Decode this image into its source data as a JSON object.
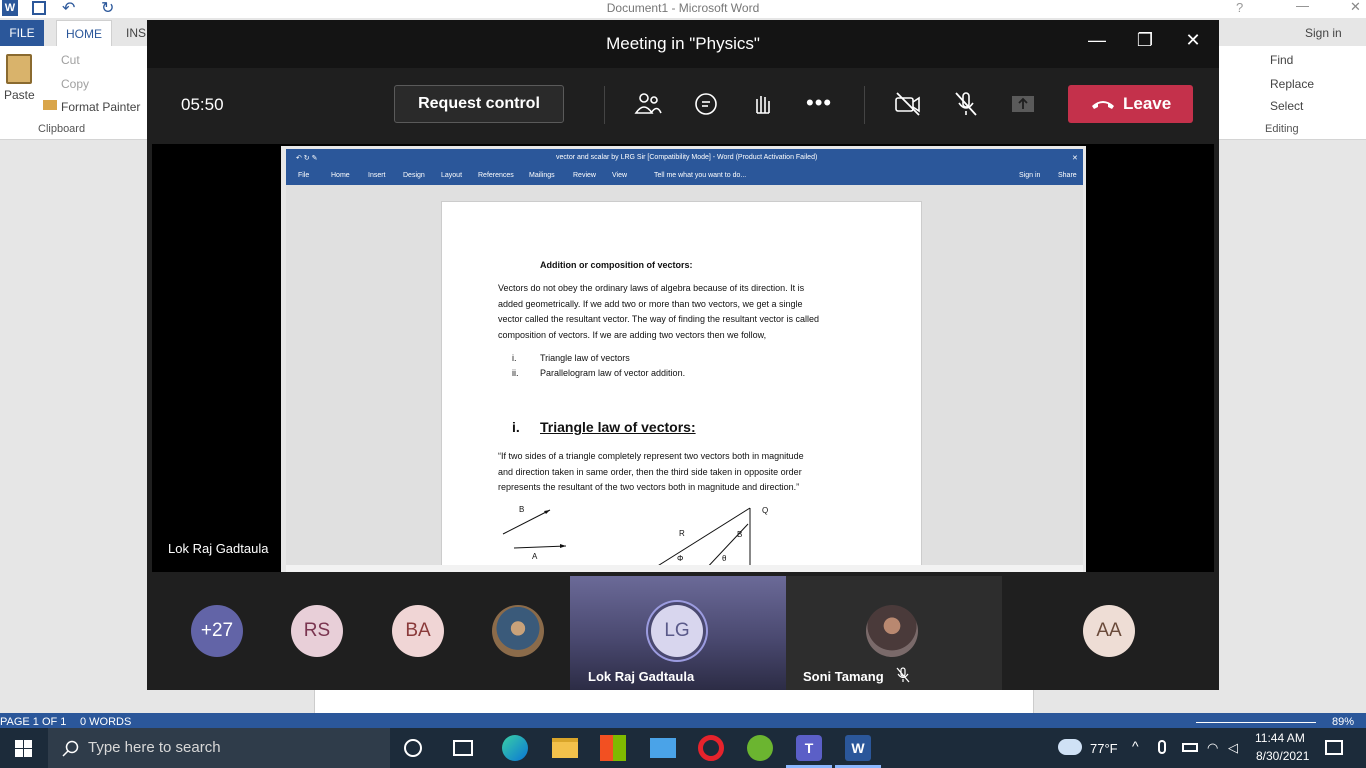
{
  "word": {
    "title": "Document1 - Microsoft Word",
    "sign_in": "Sign in",
    "tabs": {
      "file": "FILE",
      "home": "HOME",
      "insert_partial": "INS"
    },
    "clipboard": {
      "paste": "Paste",
      "cut": "Cut",
      "copy": "Copy",
      "format_painter": "Format Painter",
      "group_label": "Clipboard"
    },
    "editing": {
      "find": "Find",
      "replace": "Replace",
      "select": "Select",
      "group_label": "Editing"
    },
    "status": {
      "page": "PAGE 1 OF 1",
      "words": "0 WORDS",
      "zoom": "89%"
    }
  },
  "teams": {
    "meeting_title": "Meeting in \"Physics\"",
    "timer": "05:50",
    "request_control": "Request control",
    "leave": "Leave",
    "presenter_name": "Lok Raj Gadtaula",
    "gallery": [
      {
        "initials": "+27",
        "color": "#6264a7",
        "text_color": "#ffffff"
      },
      {
        "initials": "RS",
        "color": "#e8cfd8",
        "text_color": "#7a3550"
      },
      {
        "initials": "BA",
        "color": "#f0d5d5",
        "text_color": "#8a3a3a"
      },
      {
        "initials": "",
        "photo": true
      }
    ],
    "active_speaker": {
      "initials": "LG",
      "name": "Lok Raj Gadtaula"
    },
    "muted_participant": {
      "name": "Soni Tamang"
    },
    "last_avatar": {
      "initials": "AA"
    }
  },
  "shared_screen": {
    "title": "vector and scalar by LRG Sir [Compatibility Mode] - Word (Product Activation Failed)",
    "sign_in": "Sign in",
    "share": "Share",
    "tabs": [
      "File",
      "Home",
      "Insert",
      "Design",
      "Layout",
      "References",
      "Mailings",
      "Review",
      "View"
    ],
    "tell_me": "Tell me what you want to do...",
    "heading": "Addition or composition of vectors:",
    "para1": [
      "Vectors do not obey the ordinary laws of algebra because of its direction. It is",
      "added geometrically. If we add two or more than two vectors, we get a single",
      "vector called the resultant vector. The way of finding the resultant vector is called",
      "composition of vectors. If we are adding two vectors then we follow,"
    ],
    "list": [
      {
        "num": "i.",
        "text": "Triangle law of vectors"
      },
      {
        "num": "ii.",
        "text": "Parallelogram law of vector addition."
      }
    ],
    "section_num": "i.",
    "section_title": "Triangle law of vectors:",
    "para2": [
      "“If two sides of a triangle completely represent two vectors both in magnitude",
      "and direction taken in same order, then the third side taken in opposite order",
      "represents the resultant of the two vectors both in magnitude and direction.”"
    ],
    "diagram_labels": {
      "b": "B",
      "a": "A",
      "r": "R",
      "q": "Q",
      "phi": "Φ",
      "theta": "θ"
    }
  },
  "taskbar": {
    "search_placeholder": "Type here to search",
    "weather": "77°F",
    "time": "11:44 AM",
    "date": "8/30/2021"
  }
}
